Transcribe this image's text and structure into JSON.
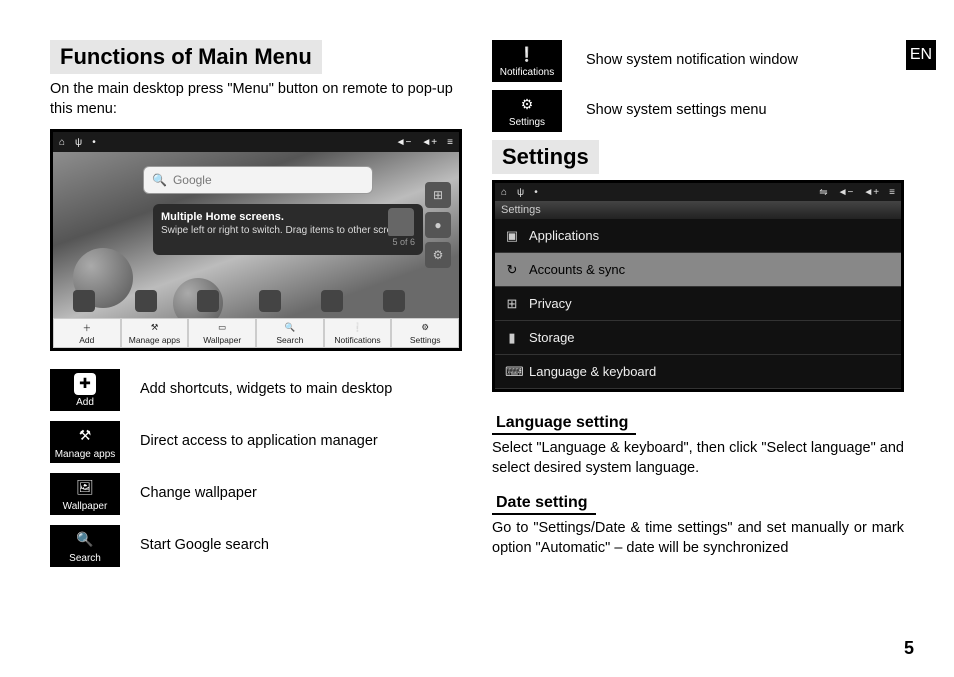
{
  "lang_tag": "EN",
  "page_number": "5",
  "left": {
    "title": "Functions of Main Menu",
    "intro": "On the main desktop press \"Menu\" button on remote to pop-up this menu:",
    "search_placeholder": "Google",
    "tooltip_title": "Multiple Home screens.",
    "tooltip_body": "Swipe left or right to switch. Drag items to other screens.",
    "tooltip_count": "5 of 6",
    "menu_strip": [
      "Add",
      "Manage apps",
      "Wallpaper",
      "Search",
      "Notifications",
      "Settings"
    ],
    "items": [
      {
        "label": "Add",
        "desc": "Add shortcuts, widgets to main desktop"
      },
      {
        "label": "Manage apps",
        "desc": "Direct access to application manager"
      },
      {
        "label": "Wallpaper",
        "desc": "Change wallpaper"
      },
      {
        "label": "Search",
        "desc": "Start Google search"
      }
    ]
  },
  "right": {
    "top_items": [
      {
        "label": "Notifications",
        "desc": "Show system notification window"
      },
      {
        "label": "Settings",
        "desc": "Show system settings menu"
      }
    ],
    "title": "Settings",
    "settings_header": "Settings",
    "settings_rows": [
      "Applications",
      "Accounts & sync",
      "Privacy",
      "Storage",
      "Language & keyboard"
    ],
    "selected_index": 1,
    "lang_head": "Language setting",
    "lang_body": "Select \"Language & keyboard\", then click \"Select language\" and select desired system language.",
    "date_head": "Date setting",
    "date_body": "Go to \"Settings/Date & time settings\" and set manually or mark option \"Automatic\" – date will be synchronized"
  }
}
